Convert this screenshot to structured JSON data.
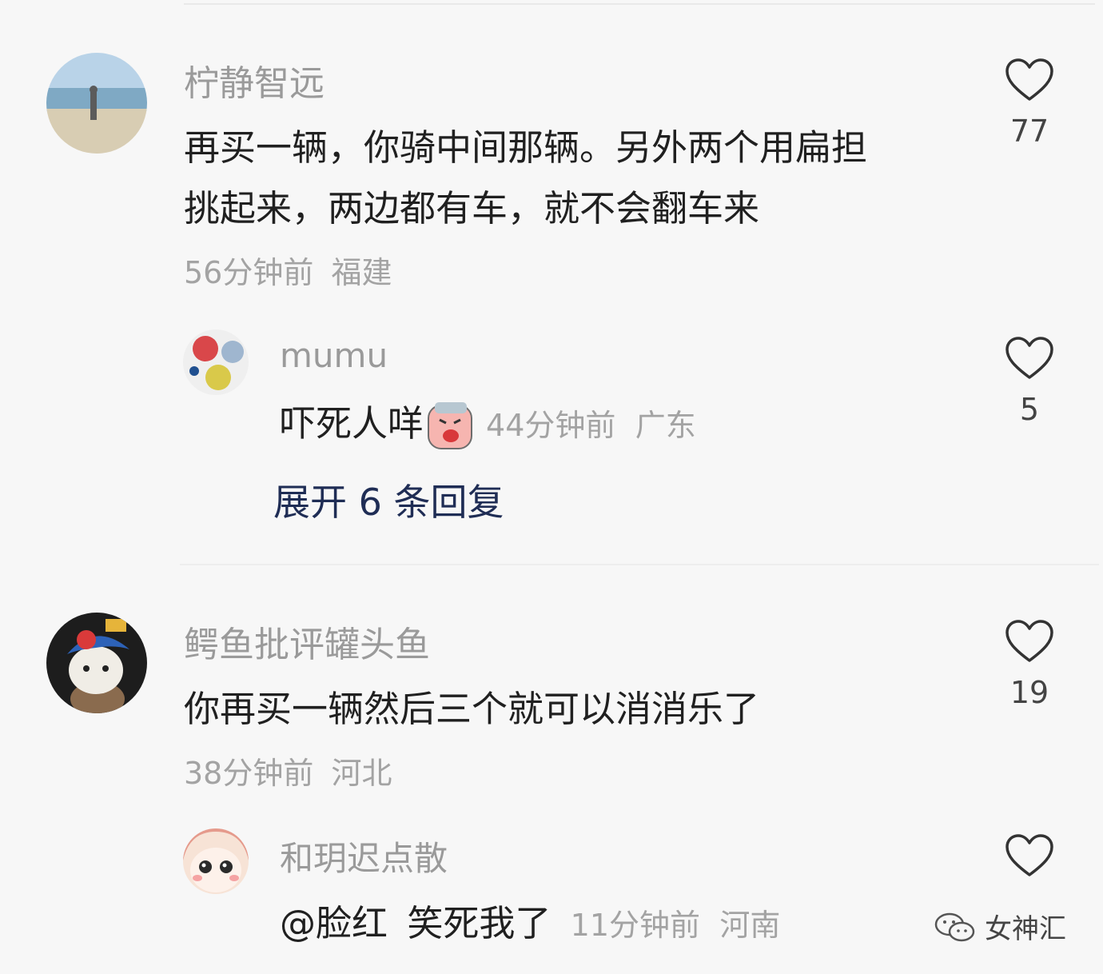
{
  "comments": [
    {
      "username": "柠静智远",
      "text_line1": "再买一辆，你骑中间那辆。另外两个用扁担",
      "text_line2": "挑起来，两边都有车，就不会翻车来",
      "time": "56分钟前",
      "location": "福建",
      "likes": "77",
      "reply": {
        "username": "mumu",
        "text": "吓死人咩",
        "time": "44分钟前",
        "location": "广东",
        "likes": "5"
      },
      "expand_label": "展开 6 条回复"
    },
    {
      "username": "鳄鱼批评罐头鱼",
      "text": "你再买一辆然后三个就可以消消乐了",
      "time": "38分钟前",
      "location": "河北",
      "likes": "19",
      "reply": {
        "username": "和玥迟点散",
        "mention": "@脸红",
        "text": "笑死我了",
        "time": "11分钟前",
        "location": "河南"
      }
    }
  ],
  "watermark": {
    "label": "女神汇",
    "icon": "wechat-icon"
  },
  "colors": {
    "username": "#9a9a9a",
    "text": "#202020",
    "meta": "#a3a3a3",
    "expand": "#1f2d55"
  }
}
